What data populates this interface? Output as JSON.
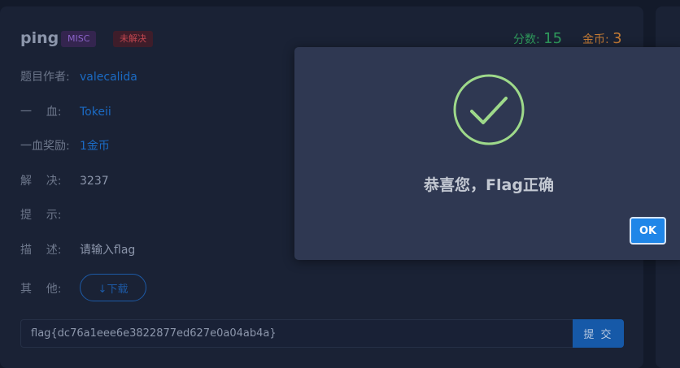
{
  "challenge": {
    "title": "ping",
    "category_badge": "MISC",
    "status_badge": "未解决",
    "score_label": "分数: ",
    "score_value": "15",
    "gold_label": "金币: ",
    "gold_value": "3"
  },
  "details": {
    "author_label": "题目作者:",
    "author_value": "valecalida",
    "first_blood_label": "一    血:",
    "first_blood_value": "Tokeii",
    "reward_label": "一血奖励:",
    "reward_value": "1金币",
    "solves_label": "解    决:",
    "solves_value": "3237",
    "hint_label": "提    示:",
    "desc_label": "描    述:",
    "desc_value": "请输入flag",
    "other_label": "其    他:",
    "download_label": "↓下载"
  },
  "flag_form": {
    "value": "flag{dc76a1eee6e3822877ed627e0a04ab4a}",
    "submit_label": "提 交"
  },
  "modal": {
    "message": "恭喜您，Flag正确",
    "ok_label": "OK",
    "icon": "check-circle-icon",
    "icon_color": "#9ed98a"
  },
  "colors": {
    "link": "#1b6bc4",
    "score": "#2f9a5c",
    "gold": "#c27a35",
    "accent_button": "#1f86e8"
  }
}
